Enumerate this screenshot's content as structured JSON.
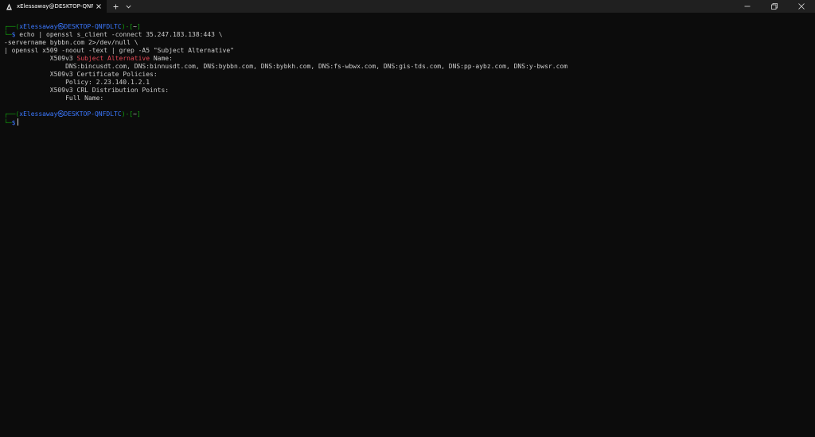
{
  "window": {
    "tab_title": "xElessaway@DESKTOP-QNFDLTC: ~",
    "icons": {
      "tab": "kali-dragon-icon",
      "tab_close": "close-icon",
      "new_tab": "plus-icon",
      "dropdown": "chevron-down-icon",
      "minimize": "minimize-icon",
      "maximize": "restore-icon",
      "close": "close-icon"
    }
  },
  "colors": {
    "background": "#0c0c0c",
    "titlebar": "#202020",
    "prompt_frame": "#13a10e",
    "prompt_user": "#3b78ff",
    "highlight": "#e74856",
    "text": "#cccccc"
  },
  "terminal": {
    "prompt1": {
      "frame_open": "┌──(",
      "user_host": "xElessaway㉿DESKTOP-QNFDLTC",
      "frame_mid": ")-[",
      "dir": "~",
      "frame_close": "]",
      "frame_bottom": "└─",
      "symbol": "$"
    },
    "command": {
      "line1": " echo | openssl s_client -connect 35.247.183.138:443 \\",
      "line2": "-servername bybbn.com 2>/dev/null \\",
      "line3": "| openssl x509 -noout -text | grep -A5 \"Subject Alternative\""
    },
    "output": {
      "san_prefix": "            X509v3 ",
      "san_highlight": "Subject Alternative",
      "san_suffix": " Name:",
      "dns_line": "                DNS:bincusdt.com, DNS:binnusdt.com, DNS:bybbn.com, DNS:bybkh.com, DNS:fs-wbwx.com, DNS:gis-tds.com, DNS:pp-aybz.com, DNS:y-bwsr.com",
      "cert_policies": "            X509v3 Certificate Policies:",
      "policy": "                Policy: 2.23.140.1.2.1",
      "crl": "            X509v3 CRL Distribution Points:",
      "full_name": "                Full Name:"
    },
    "prompt2": {
      "frame_open": "┌──(",
      "user_host": "xElessaway㉿DESKTOP-QNFDLTC",
      "frame_mid": ")-[",
      "dir": "~",
      "frame_close": "]",
      "frame_bottom": "└─",
      "symbol": "$"
    }
  }
}
